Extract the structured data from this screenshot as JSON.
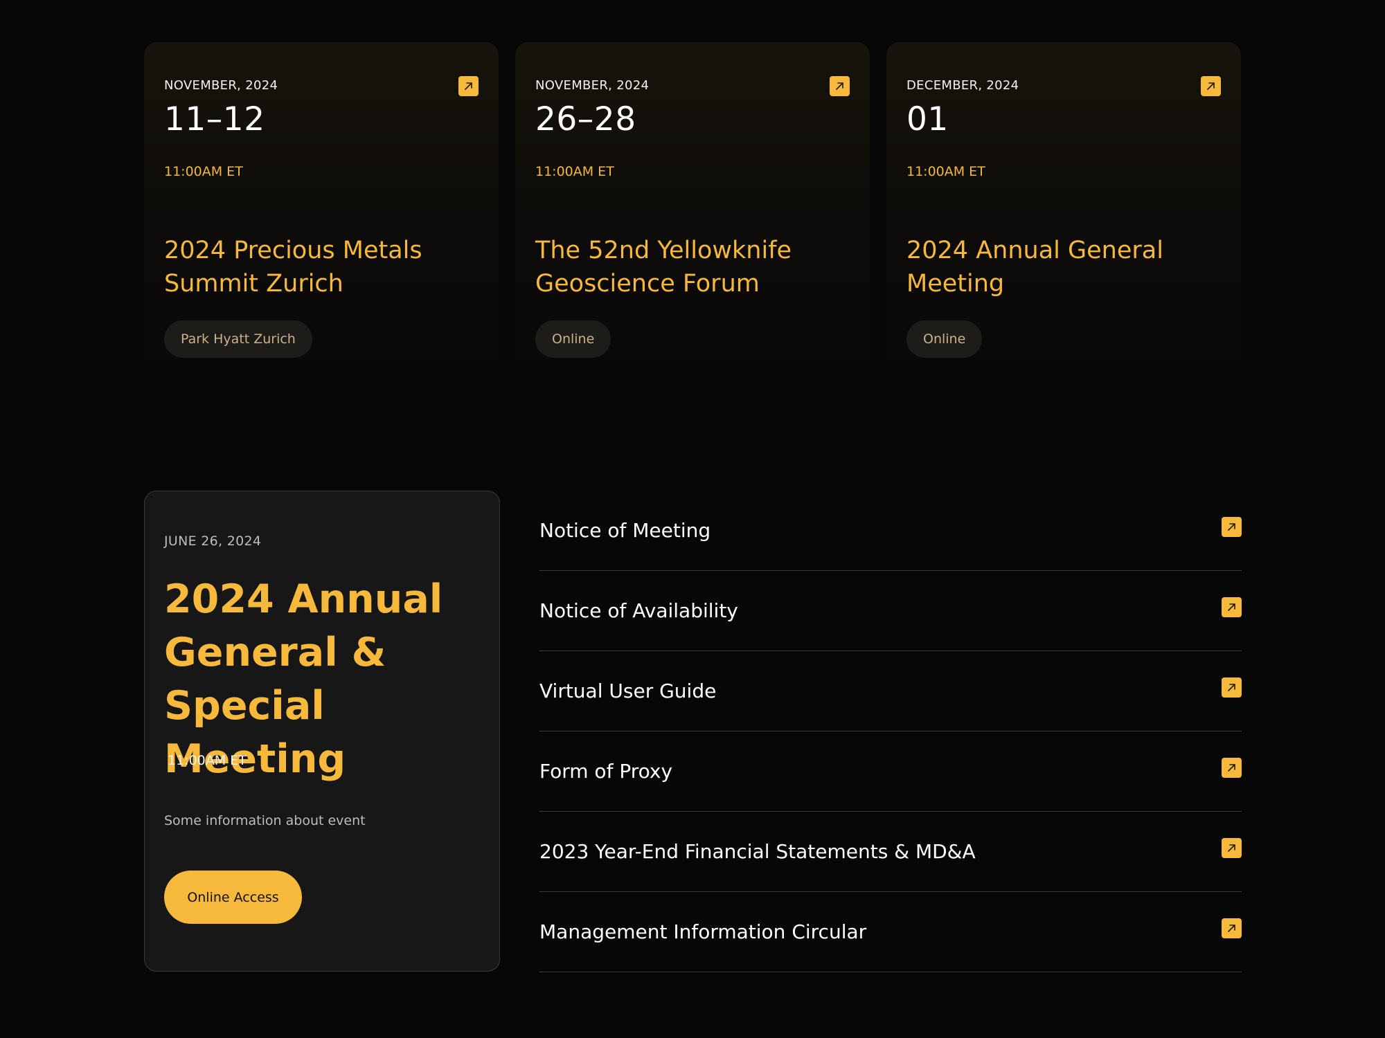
{
  "events": [
    {
      "month": "NOVEMBER, 2024",
      "days": "11–12",
      "time": "11:00AM ET",
      "title": "2024 Precious Metals Summit Zurich",
      "location": "Park Hyatt Zurich"
    },
    {
      "month": "NOVEMBER, 2024",
      "days": "26–28",
      "time": "11:00AM ET",
      "title": "The 52nd Yellowknife Geoscience Forum",
      "location": "Online"
    },
    {
      "month": "DECEMBER, 2024",
      "days": "01",
      "time": "11:00AM ET",
      "title": "2024 Annual General Meeting",
      "location": "Online"
    }
  ],
  "featured": {
    "date": "JUNE 26, 2024",
    "title": "2024 Annual General & Special Meeting",
    "time": "11:00AM ET",
    "description": "Some information about event",
    "button_label": "Online Access"
  },
  "documents": [
    {
      "label": "Notice of Meeting"
    },
    {
      "label": "Notice of Availability"
    },
    {
      "label": "Virtual User Guide"
    },
    {
      "label": "Form of Proxy"
    },
    {
      "label": "2023 Year-End Financial Statements & MD&A"
    },
    {
      "label": "Management Information Circular"
    }
  ],
  "colors": {
    "accent": "#f6b93b",
    "background": "#070707",
    "card": "#171717",
    "divider": "#3a3a3a"
  },
  "icons": {
    "external_link": "arrow-up-right-icon"
  }
}
